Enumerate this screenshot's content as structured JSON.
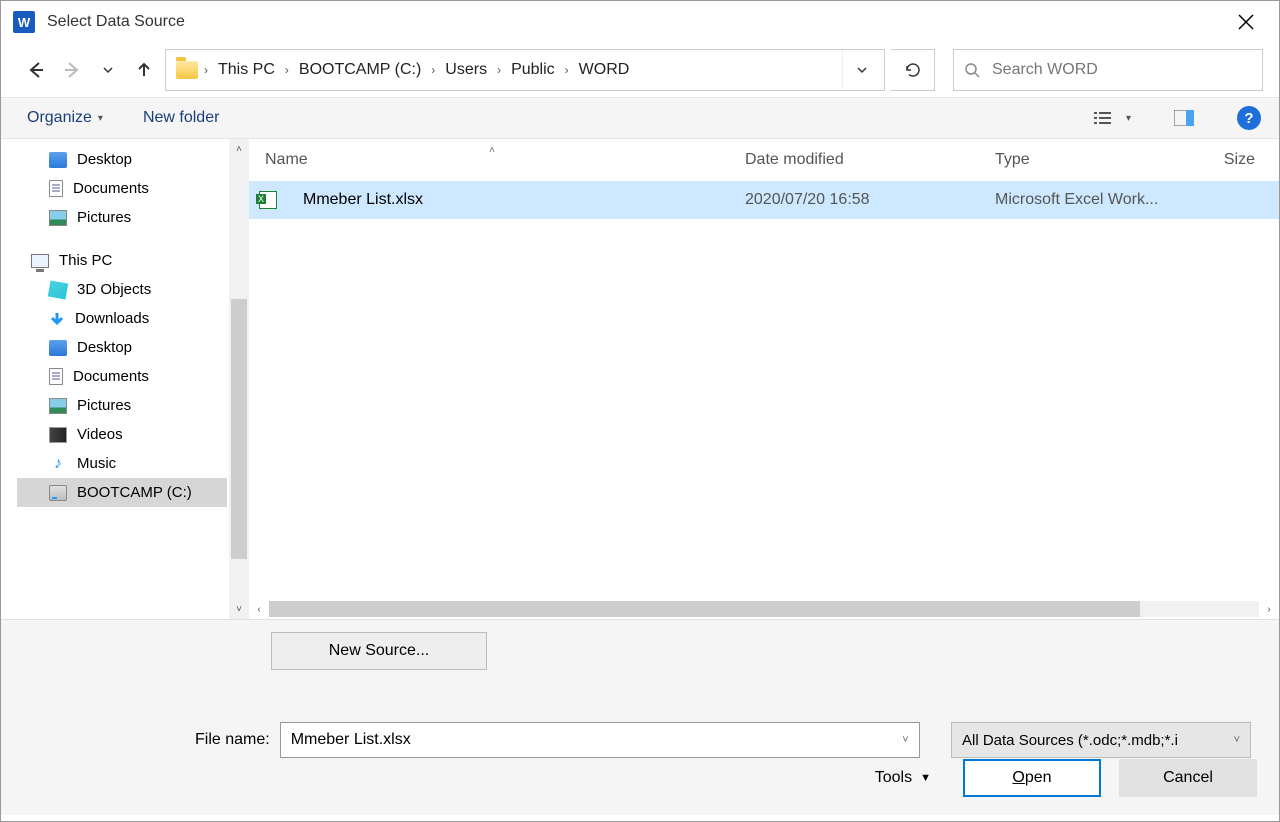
{
  "title": "Select Data Source",
  "breadcrumb": {
    "items": [
      "This PC",
      "BOOTCAMP (C:)",
      "Users",
      "Public",
      "WORD"
    ]
  },
  "search": {
    "placeholder": "Search WORD"
  },
  "toolbar": {
    "organize": "Organize",
    "newfolder": "New folder",
    "help": "?"
  },
  "sidebar": {
    "quick": [
      {
        "label": "Desktop",
        "icon": "folder-blue"
      },
      {
        "label": "Documents",
        "icon": "doc"
      },
      {
        "label": "Pictures",
        "icon": "pic"
      }
    ],
    "thispc_label": "This PC",
    "thispc_items": [
      {
        "label": "3D Objects",
        "icon": "cube"
      },
      {
        "label": "Downloads",
        "icon": "arrow-down"
      },
      {
        "label": "Desktop",
        "icon": "folder-blue"
      },
      {
        "label": "Documents",
        "icon": "doc"
      },
      {
        "label": "Pictures",
        "icon": "pic"
      },
      {
        "label": "Videos",
        "icon": "video"
      },
      {
        "label": "Music",
        "icon": "music"
      },
      {
        "label": "BOOTCAMP (C:)",
        "icon": "drive",
        "selected": true
      }
    ]
  },
  "columns": {
    "name": "Name",
    "date": "Date modified",
    "type": "Type",
    "size": "Size"
  },
  "files": [
    {
      "name": "Mmeber List.xlsx",
      "date": "2020/07/20 16:58",
      "type": "Microsoft Excel Work..."
    }
  ],
  "lower": {
    "newsource": "New Source...",
    "filename_label": "File name:",
    "filename_value": "Mmeber List.xlsx",
    "filetype": "All Data Sources (*.odc;*.mdb;*.i",
    "tools": "Tools",
    "open": "Open",
    "cancel": "Cancel"
  }
}
